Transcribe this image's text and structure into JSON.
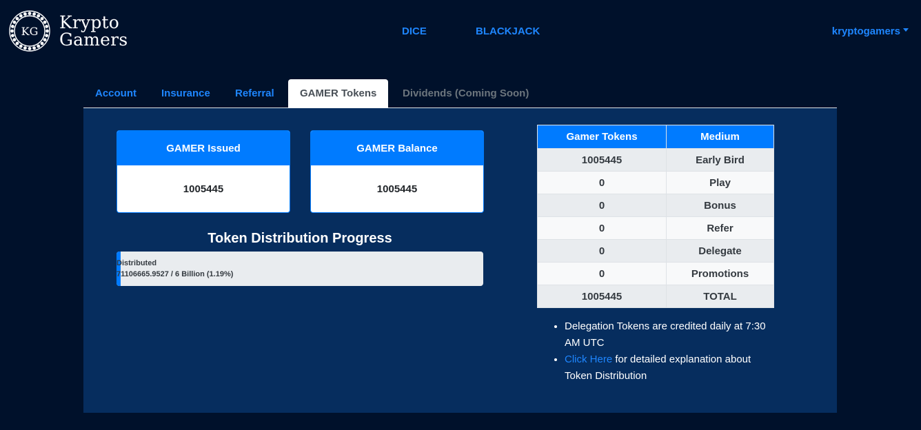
{
  "brand": {
    "monogram": "KG",
    "line1": "Krypto",
    "line2": "Gamers"
  },
  "nav": {
    "links": [
      "DICE",
      "BLACKJACK"
    ],
    "user": "kryptogamers"
  },
  "tabs": [
    {
      "label": "Account",
      "state": "link"
    },
    {
      "label": "Insurance",
      "state": "link"
    },
    {
      "label": "Referral",
      "state": "link"
    },
    {
      "label": "GAMER Tokens",
      "state": "active"
    },
    {
      "label": "Dividends (Coming Soon)",
      "state": "disabled"
    }
  ],
  "cards": [
    {
      "title": "GAMER Issued",
      "value": "1005445"
    },
    {
      "title": "GAMER Balance",
      "value": "1005445"
    }
  ],
  "progress": {
    "title": "Token Distribution Progress",
    "label": "Distributed",
    "detail": "71106665.9527 / 6 Billion (1.19%)",
    "percent": 1.19
  },
  "table": {
    "headers": [
      "Gamer Tokens",
      "Medium"
    ],
    "rows": [
      [
        "1005445",
        "Early Bird"
      ],
      [
        "0",
        "Play"
      ],
      [
        "0",
        "Bonus"
      ],
      [
        "0",
        "Refer"
      ],
      [
        "0",
        "Delegate"
      ],
      [
        "0",
        "Promotions"
      ],
      [
        "1005445",
        "TOTAL"
      ]
    ]
  },
  "notes": {
    "item1": "Delegation Tokens are credited daily at 7:30 AM UTC",
    "item2_link": "Click Here",
    "item2_text": " for detailed explanation about Token Distribution"
  },
  "colors": {
    "page_bg": "#00112b",
    "panel_bg": "#062d5e",
    "accent": "#007bff",
    "link": "#1e86ff"
  }
}
